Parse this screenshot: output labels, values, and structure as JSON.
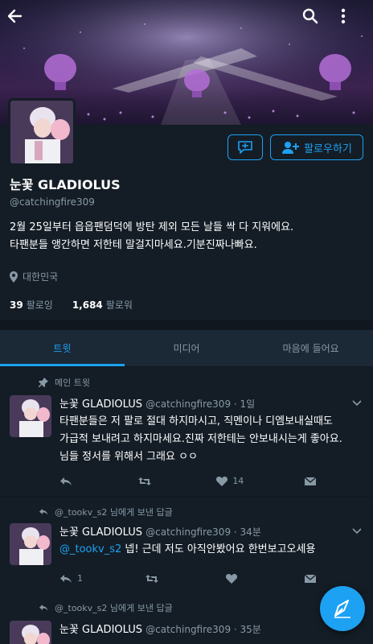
{
  "profile": {
    "name": "눈꽃 GLADIOLUS",
    "handle": "@catchingfire309",
    "bio_line1": "2월 25일부터 읍읍팬덤덕에 방탄 제외 모든 날들 싹 다 지워에요.",
    "bio_line2": "타팬분들 앵간하면 저한테 말걸지마세요.기분진짜나빠요.",
    "location": "대한민국",
    "following_count": "39",
    "following_label": "팔로잉",
    "followers_count": "1,684",
    "followers_label": "팔로워",
    "follow_button_label": "팔로우하기"
  },
  "tabs": [
    {
      "label": "트윗",
      "active": true
    },
    {
      "label": "미디어",
      "active": false
    },
    {
      "label": "마음에 들어요",
      "active": false
    }
  ],
  "tweets": [
    {
      "context": "메인 트윗",
      "name": "눈꽃 GLADIOLUS",
      "meta": "@catchingfire309 · 1일",
      "line1": "타팬분들은 저 팔로 절대 하지마시고, 직멘이나 디엠보내실때도",
      "line2": "가급적 보내려고 하지마세요.진짜 저한테는 안보내시는게 좋아요.",
      "line3": "님들 정서를 위해서 그래요 ㅇㅇ",
      "reply_count": "",
      "retweet_count": "",
      "like_count": "14"
    },
    {
      "context": "@_tookv_s2 님에게 보낸 답글",
      "name": "눈꽃 GLADIOLUS",
      "meta": "@catchingfire309 · 34분",
      "mention": "@_tookv_s2",
      "text": " 넵! 근데 저도 아직안봤어요 한번보고오세용",
      "reply_count": "1",
      "retweet_count": "",
      "like_count": ""
    },
    {
      "context": "@_tookv_s2 님에게 보낸 답글",
      "name": "눈꽃 GLADIOLUS",
      "meta": "@catchingfire309 · 35분"
    }
  ],
  "colors": {
    "accent": "#1da1f2",
    "background": "#141d26",
    "muted": "#8899a6"
  }
}
